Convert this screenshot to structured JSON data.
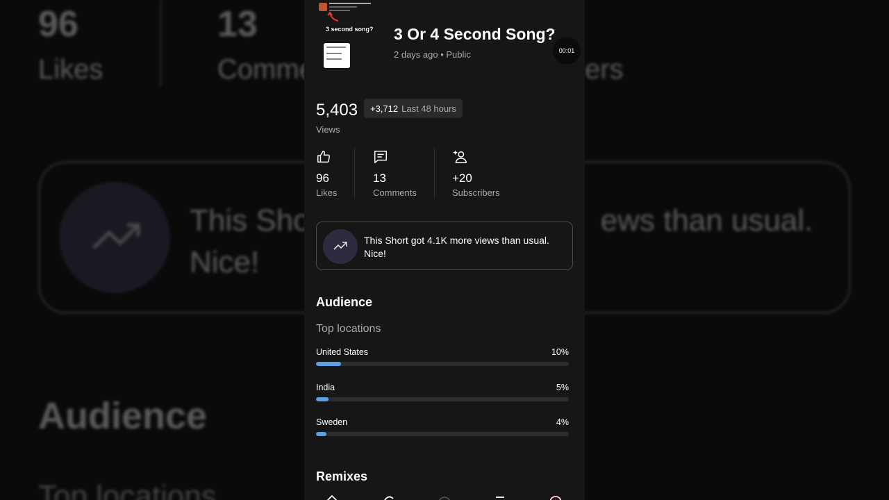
{
  "background": {
    "likes_count": "96",
    "likes_label": "Likes",
    "comments_count": "13",
    "comments_label": "Comme",
    "subscribers_tail": "ers",
    "insight_line1_left": "This Sho",
    "insight_line1_right": "ews than usual.",
    "insight_line2": "Nice!",
    "audience_heading": "Audience",
    "top_locations": "Top locations"
  },
  "thumbnail": {
    "caption": "3 second song?"
  },
  "video": {
    "title": "3 Or 4 Second Song?",
    "meta": "2 days ago • Public",
    "timer": "00:01"
  },
  "views": {
    "count": "5,403",
    "label": "Views",
    "delta": "+3,712",
    "period": "Last 48 hours"
  },
  "stats": {
    "likes": {
      "value": "96",
      "label": "Likes",
      "icon": "thumbs-up-icon"
    },
    "comments": {
      "value": "13",
      "label": "Comments",
      "icon": "comment-icon"
    },
    "subscribers": {
      "value": "+20",
      "label": "Subscribers",
      "icon": "add-person-icon"
    }
  },
  "insight": {
    "text": "This Short got 4.1K more views than usual. Nice!",
    "icon": "trending-up-icon"
  },
  "audience": {
    "title": "Audience",
    "top_locations_title": "Top locations",
    "locations": [
      {
        "name": "United States",
        "pct_label": "10%",
        "fraction": 0.1
      },
      {
        "name": "India",
        "pct_label": "5%",
        "fraction": 0.05
      },
      {
        "name": "Sweden",
        "pct_label": "4%",
        "fraction": 0.04
      }
    ]
  },
  "remixes": {
    "title": "Remixes"
  },
  "colors": {
    "bar_fill": "#5aa0e8",
    "panel_bg": "#161616",
    "insight_icon_bg": "#2c2b40"
  }
}
